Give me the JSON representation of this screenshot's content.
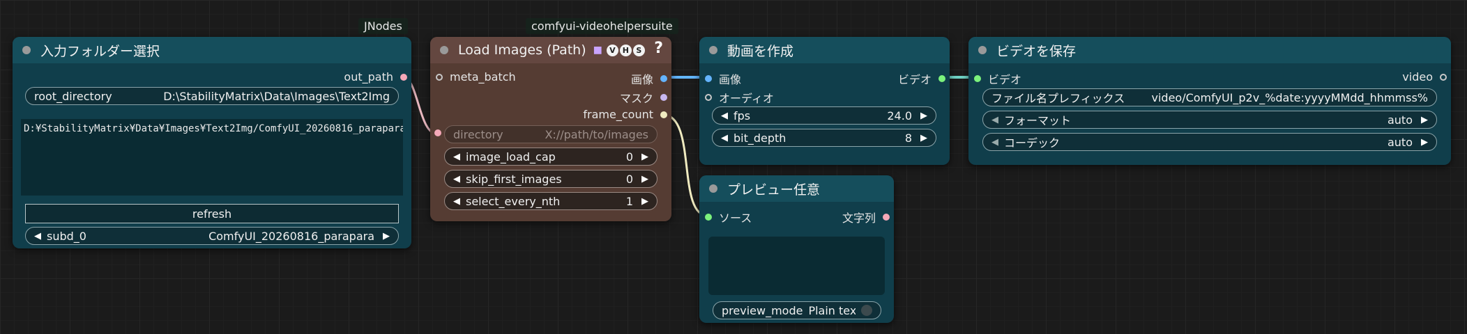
{
  "badges": {
    "jnodes": "JNodes",
    "vhs": "comfyui-videohelpersuite"
  },
  "colors": {
    "image_link": "#63b6ff",
    "video_link": "#6fd2c4",
    "path_link": "#e8b8c0",
    "frame_link": "#f0ebc0",
    "slot_green": "#7cf27c",
    "slot_pink": "#f4a8b8",
    "slot_blue": "#64b4ff",
    "slot_lavender": "#c8b8f0"
  },
  "folder_node": {
    "title": "入力フォルダー選択",
    "output": "out_path",
    "root_label": "root_directory",
    "root_value": "D:\\StabilityMatrix\\Data\\Images\\Text2Img",
    "text": "D:¥StabilityMatrix¥Data¥Images¥Text2Img/ComfyUI_20260816_parapara",
    "refresh": "refresh",
    "subd_label": "subd_0",
    "subd_value": "ComfyUI_20260816_parapara"
  },
  "load_node": {
    "title": "Load Images (Path)",
    "vhs_letters": [
      "V",
      "H",
      "S"
    ],
    "help": "?",
    "input": "meta_batch",
    "outputs": [
      "画像",
      "マスク",
      "frame_count"
    ],
    "directory_label": "directory",
    "directory_placeholder": "X://path/to/images",
    "widgets": [
      {
        "label": "image_load_cap",
        "value": "0"
      },
      {
        "label": "skip_first_images",
        "value": "0"
      },
      {
        "label": "select_every_nth",
        "value": "1"
      }
    ]
  },
  "create_node": {
    "title": "動画を作成",
    "inputs": [
      "画像",
      "オーディオ"
    ],
    "output": "ビデオ",
    "widgets": [
      {
        "label": "fps",
        "value": "24.0"
      },
      {
        "label": "bit_depth",
        "value": "8"
      }
    ]
  },
  "preview_node": {
    "title": "プレビュー任意",
    "input": "ソース",
    "output": "文字列",
    "mode_label": "preview_mode",
    "mode_value": "Plain text"
  },
  "save_node": {
    "title": "ビデオを保存",
    "input": "ビデオ",
    "output": "video",
    "prefix_label": "ファイル名プレフィックス",
    "prefix_value": "video/ComfyUI_p2v_%date:yyyyMMdd_hhmmss%",
    "widgets": [
      {
        "label": "フォーマット",
        "value": "auto"
      },
      {
        "label": "コーデック",
        "value": "auto"
      }
    ]
  }
}
